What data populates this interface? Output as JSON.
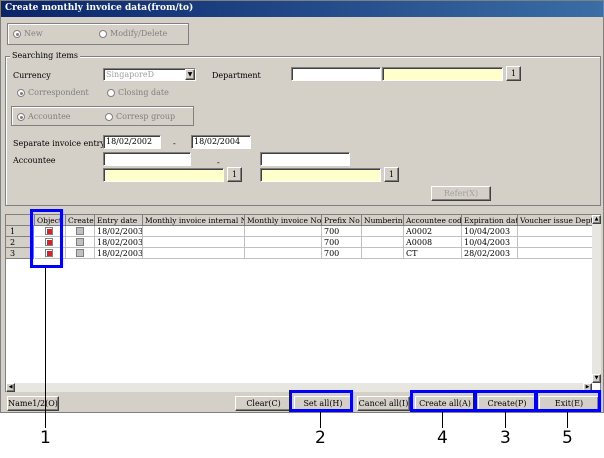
{
  "window": {
    "title": "Create monthly invoice data(from/to)"
  },
  "mode": {
    "new_label": "New",
    "modify_label": "Modify/Delete"
  },
  "search": {
    "group_label": "Searching items",
    "currency_label": "Currency",
    "currency_value": "SingaporeD",
    "department_label": "Department",
    "correspondent_label": "Correspondent",
    "closing_date_label": "Closing date",
    "accountee_radio_label": "Accountee",
    "corresp_group_label": "Corresp group",
    "separate_label": "Separate invoice entry",
    "date_from": "18/02/2002",
    "date_dash": "-",
    "date_to": "18/02/2004",
    "accountee_label": "Accountee",
    "accountee_dash": "-",
    "one_label": "1",
    "refer_label": "Refer(X)"
  },
  "table": {
    "headers": [
      "Object",
      "Created",
      "Entry date",
      "Monthly invoice internal No",
      "Monthly invoice  No",
      "Prefix No",
      "Numbering",
      "Accountee code",
      "Expiration date",
      "Voucher issue Dept."
    ],
    "rows": [
      {
        "n": "1",
        "entry": "18/02/2003",
        "prefix": "700",
        "code": "A0002",
        "exp": "10/04/2003"
      },
      {
        "n": "2",
        "entry": "18/02/2003",
        "prefix": "700",
        "code": "A0008",
        "exp": "10/04/2003"
      },
      {
        "n": "3",
        "entry": "18/02/2003",
        "prefix": "700",
        "code": "CT",
        "exp": "28/02/2003"
      }
    ]
  },
  "footer": {
    "name_label": "Name1/2(O)",
    "clear_label": "Clear(C)",
    "set_all_label": "Set all(H)",
    "cancel_all_label": "Cancel all(I)",
    "create_all_label": "Create all(A)",
    "create_label": "Create(P)",
    "exit_label": "Exit(E)"
  },
  "callouts": [
    "1",
    "2",
    "4",
    "3",
    "5"
  ]
}
